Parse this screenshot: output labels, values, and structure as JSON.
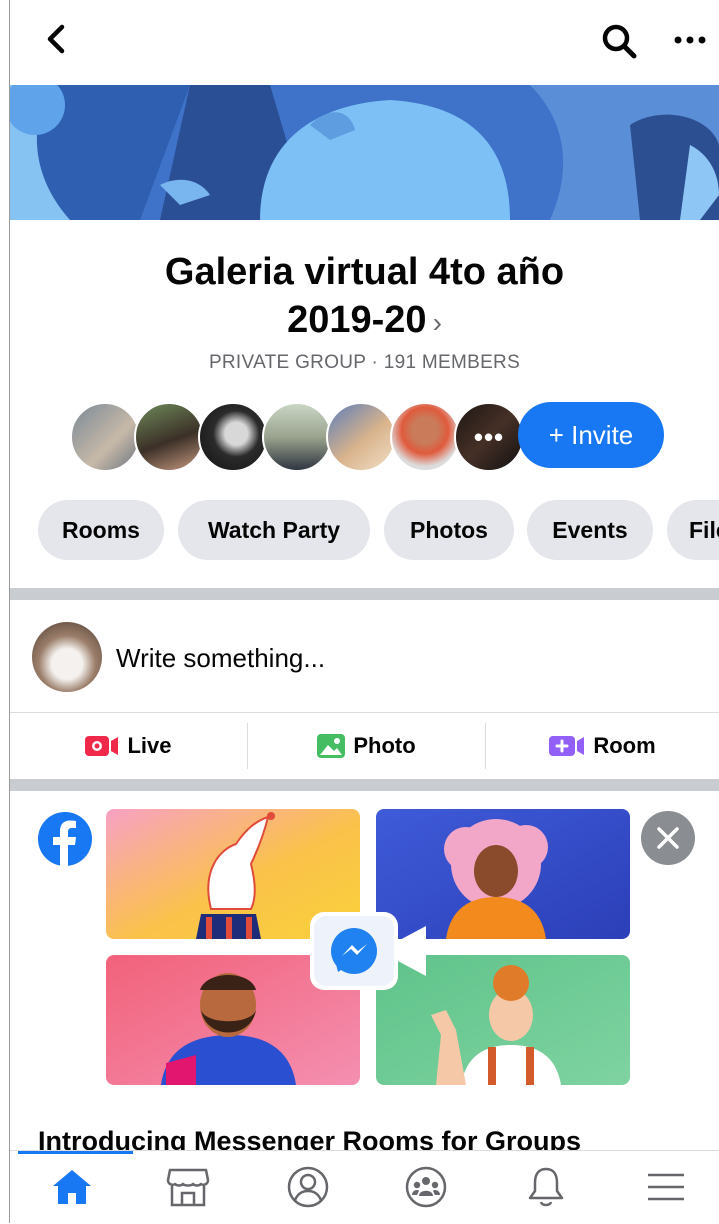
{
  "group": {
    "name_line1": "Galeria virtual 4to año",
    "name_line2": "2019-20",
    "chevron": "›",
    "meta": "PRIVATE GROUP · 191 MEMBERS",
    "more_members_label": "•••",
    "invite_label": "+ Invite"
  },
  "chips": [
    {
      "label": "Rooms"
    },
    {
      "label": "Watch Party"
    },
    {
      "label": "Photos"
    },
    {
      "label": "Events"
    },
    {
      "label": "Files"
    }
  ],
  "composer": {
    "placeholder": "Write something..."
  },
  "actions": {
    "live": "Live",
    "photo": "Photo",
    "room": "Room"
  },
  "promo": {
    "title": "Introducing Messenger Rooms for Groups"
  },
  "icons": {
    "back": "back-chevron-icon",
    "search": "search-icon",
    "more": "more-options-icon",
    "nav": [
      "home-icon",
      "marketplace-icon",
      "profile-icon",
      "groups-icon",
      "notifications-icon",
      "menu-icon"
    ]
  },
  "colors": {
    "accent": "#1877f2",
    "chip_bg": "#e4e6eb",
    "live": "#f02849",
    "photo": "#45bd62",
    "room": "#9360f7"
  }
}
